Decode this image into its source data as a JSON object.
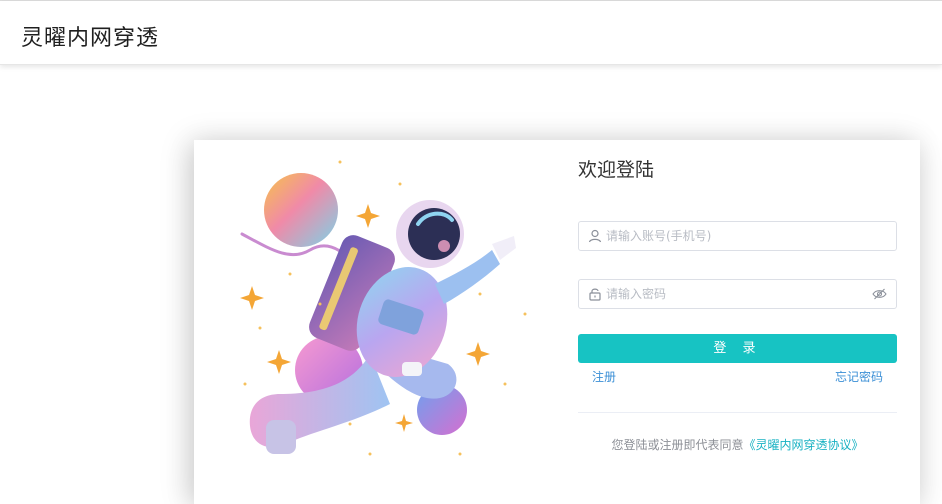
{
  "header": {
    "brand": "灵曜内网穿透"
  },
  "login": {
    "title": "欢迎登陆",
    "account_placeholder": "请输入账号(手机号)",
    "password_placeholder": "请输入密码",
    "submit_label": "登 录",
    "register_label": "注册",
    "forgot_label": "忘记密码",
    "agreement_prefix": "您登陆或注册即代表同意",
    "agreement_link": "《灵曜内网穿透协议》"
  },
  "icons": {
    "account": "user-icon",
    "password": "lock-icon",
    "toggle": "eye-off-icon"
  },
  "colors": {
    "accent": "#17c3c3",
    "link": "#3b8fd6",
    "agreement_link": "#17b1c2"
  }
}
